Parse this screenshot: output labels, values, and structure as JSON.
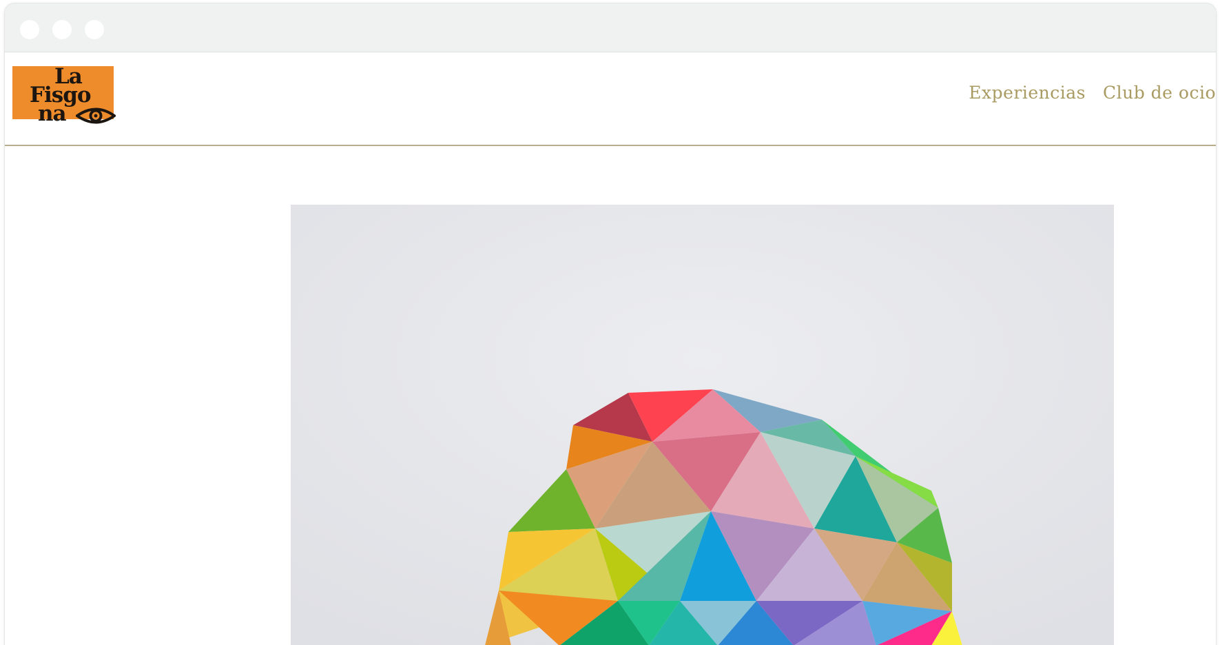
{
  "window": {
    "controls": [
      "close",
      "minimize",
      "maximize"
    ]
  },
  "header": {
    "logo": {
      "line1": "La",
      "line2": "Fisgo",
      "line3": "na",
      "icon": "eye-icon",
      "background_color": "#ee8c2c"
    },
    "nav": {
      "items": [
        {
          "label": "Experiencias"
        },
        {
          "label": "Club de ocio"
        }
      ],
      "color": "#a99a62"
    },
    "divider_color": "#b8ad8a"
  },
  "hero": {
    "image": "geometric-polyhedron-artwork"
  }
}
